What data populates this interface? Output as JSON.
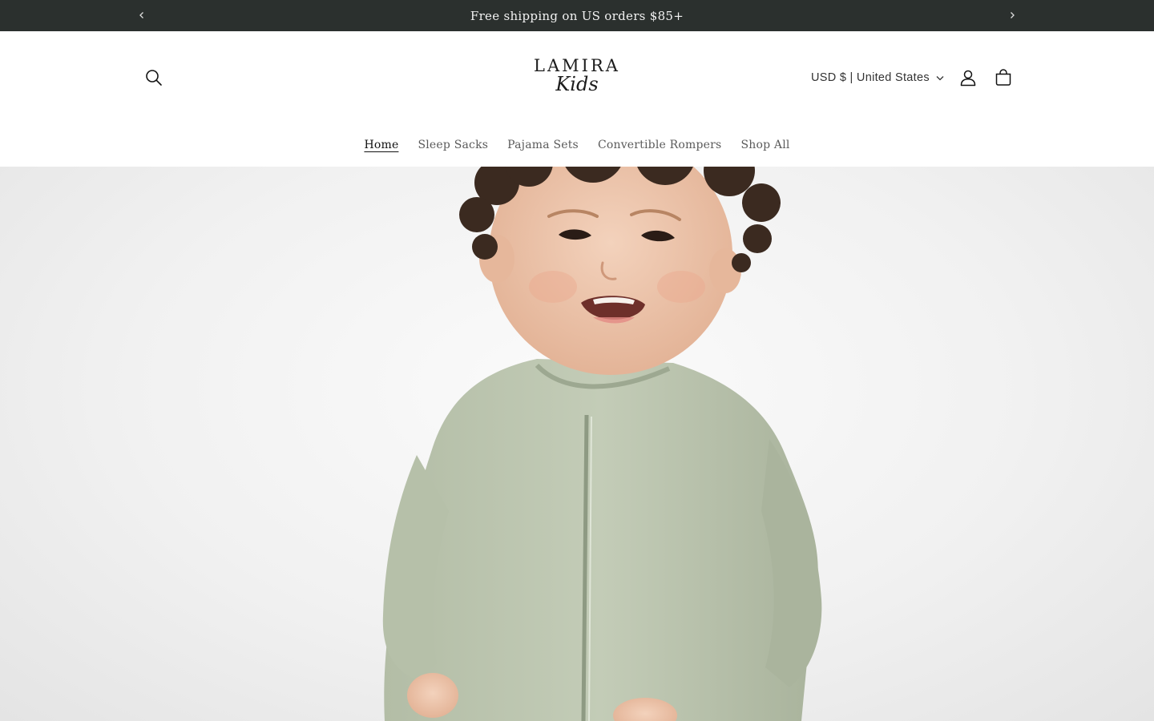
{
  "announcement": {
    "text": "Free shipping on US orders $85+",
    "prev_icon": "chevron-left-icon",
    "next_icon": "chevron-right-icon"
  },
  "header": {
    "logo": {
      "word": "LAMIRA",
      "script": "Kids"
    },
    "currency": "USD $ | United States",
    "icons": [
      "search-icon",
      "account-icon",
      "cart-icon",
      "chevron-down-icon"
    ]
  },
  "nav": {
    "items": [
      {
        "label": "Home",
        "active": true
      },
      {
        "label": "Sleep Sacks"
      },
      {
        "label": "Pajama Sets"
      },
      {
        "label": "Convertible Rompers"
      },
      {
        "label": "Shop All"
      }
    ]
  },
  "colors": {
    "announcement_bg": "#2b302e",
    "romper": "#bcc6b0",
    "text": "#121212"
  }
}
